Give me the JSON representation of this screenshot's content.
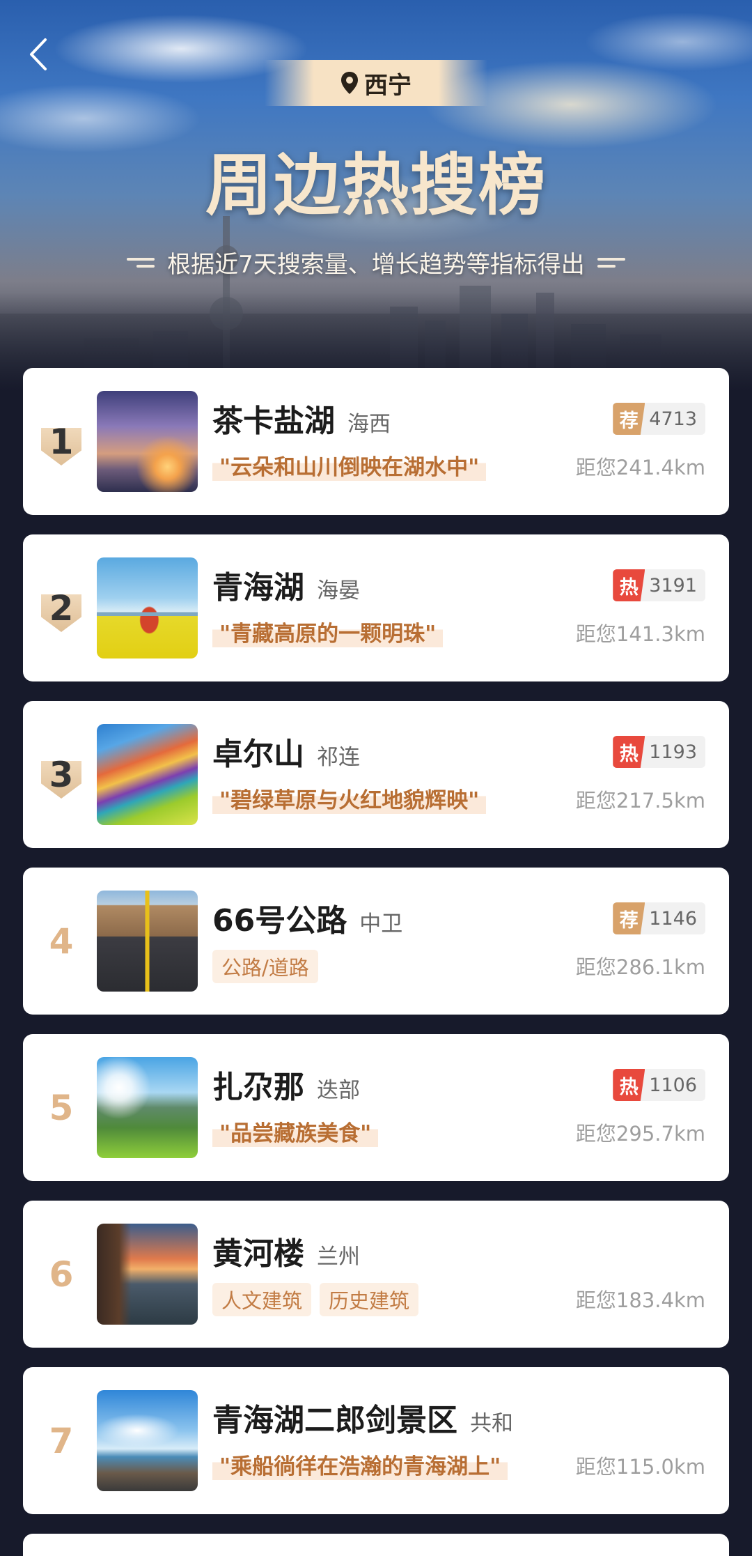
{
  "header": {
    "location": "西宁",
    "title": "周边热搜榜",
    "subtitle": "根据近7天搜索量、增长趋势等指标得出"
  },
  "items": [
    {
      "rank": "1",
      "name": "茶卡盐湖",
      "region": "海西",
      "quote": "\"云朵和山川倒映在湖水中\"",
      "tags": [],
      "badge": "荐",
      "badge_type": "rec",
      "count": "4713",
      "distance": "距您241.4km"
    },
    {
      "rank": "2",
      "name": "青海湖",
      "region": "海晏",
      "quote": "\"青藏高原的一颗明珠\"",
      "tags": [],
      "badge": "热",
      "badge_type": "hot",
      "count": "3191",
      "distance": "距您141.3km"
    },
    {
      "rank": "3",
      "name": "卓尔山",
      "region": "祁连",
      "quote": "\"碧绿草原与火红地貌辉映\"",
      "tags": [],
      "badge": "热",
      "badge_type": "hot",
      "count": "1193",
      "distance": "距您217.5km"
    },
    {
      "rank": "4",
      "name": "66号公路",
      "region": "中卫",
      "quote": "",
      "tags": [
        "公路/道路"
      ],
      "badge": "荐",
      "badge_type": "rec",
      "count": "1146",
      "distance": "距您286.1km"
    },
    {
      "rank": "5",
      "name": "扎尕那",
      "region": "迭部",
      "quote": "\"品尝藏族美食\"",
      "tags": [],
      "badge": "热",
      "badge_type": "hot",
      "count": "1106",
      "distance": "距您295.7km"
    },
    {
      "rank": "6",
      "name": "黄河楼",
      "region": "兰州",
      "quote": "",
      "tags": [
        "人文建筑",
        "历史建筑"
      ],
      "badge": "",
      "badge_type": "",
      "count": "",
      "distance": "距您183.4km"
    },
    {
      "rank": "7",
      "name": "青海湖二郎剑景区",
      "region": "共和",
      "quote": "\"乘船徜徉在浩瀚的青海湖上\"",
      "tags": [],
      "badge": "",
      "badge_type": "",
      "count": "",
      "distance": "距您115.0km"
    }
  ],
  "colors": {
    "background": "#171a2b",
    "accent_gold": "#d8a26a",
    "hot_red": "#e8493d",
    "quote_brown": "#b86e33"
  },
  "icons": {
    "back": "chevron-left-icon",
    "location": "location-pin-icon"
  }
}
